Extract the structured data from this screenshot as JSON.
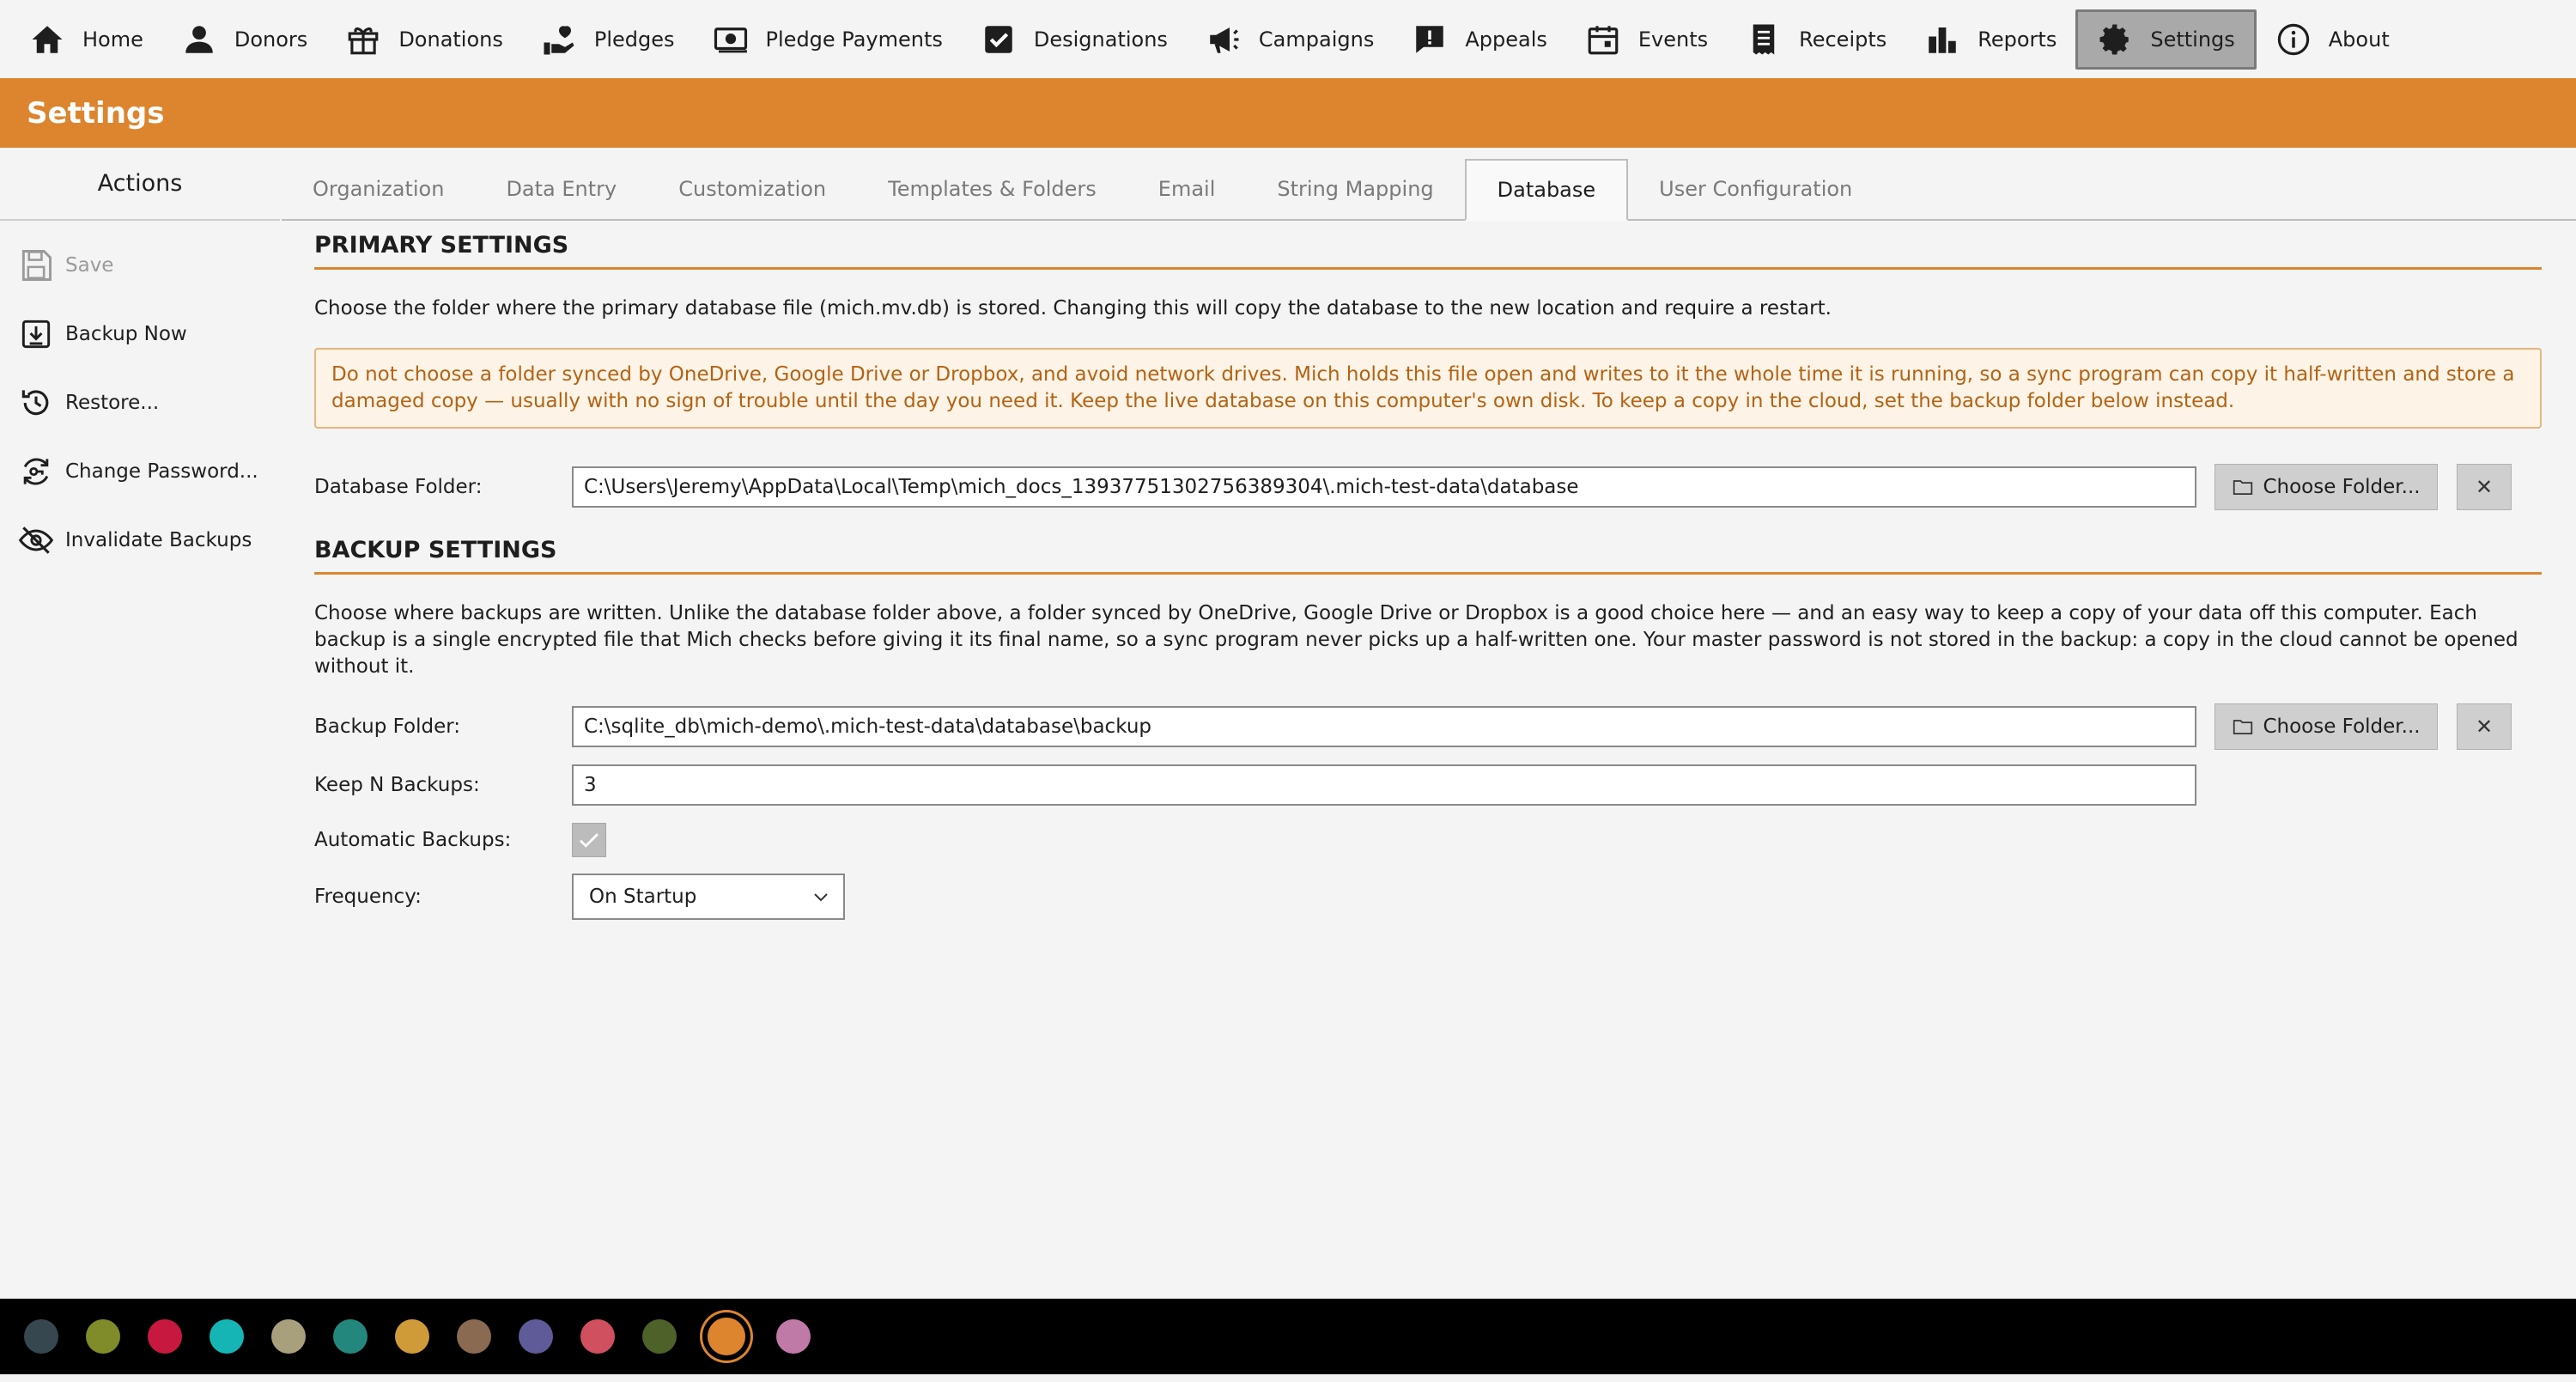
{
  "nav": [
    {
      "id": "home",
      "label": "Home",
      "icon": "home-icon"
    },
    {
      "id": "donors",
      "label": "Donors",
      "icon": "person-icon"
    },
    {
      "id": "donations",
      "label": "Donations",
      "icon": "gift-icon"
    },
    {
      "id": "pledges",
      "label": "Pledges",
      "icon": "pledge-hand-icon"
    },
    {
      "id": "pledge-payments",
      "label": "Pledge Payments",
      "icon": "money-icon"
    },
    {
      "id": "designations",
      "label": "Designations",
      "icon": "checkbox-icon"
    },
    {
      "id": "campaigns",
      "label": "Campaigns",
      "icon": "megaphone-icon"
    },
    {
      "id": "appeals",
      "label": "Appeals",
      "icon": "alert-message-icon"
    },
    {
      "id": "events",
      "label": "Events",
      "icon": "calendar-icon"
    },
    {
      "id": "receipts",
      "label": "Receipts",
      "icon": "receipt-icon"
    },
    {
      "id": "reports",
      "label": "Reports",
      "icon": "bar-chart-icon"
    },
    {
      "id": "settings",
      "label": "Settings",
      "icon": "gear-icon",
      "active": true
    },
    {
      "id": "about",
      "label": "About",
      "icon": "info-icon"
    }
  ],
  "page_title": "Settings",
  "sidebar": {
    "header": "Actions",
    "items": [
      {
        "id": "save",
        "label": "Save",
        "icon": "floppy-disk-icon",
        "disabled": true
      },
      {
        "id": "backup-now",
        "label": "Backup Now",
        "icon": "archive-download-icon",
        "disabled": false
      },
      {
        "id": "restore",
        "label": "Restore...",
        "icon": "restore-history-icon",
        "disabled": false
      },
      {
        "id": "change-password",
        "label": "Change Password...",
        "icon": "key-cycle-icon",
        "disabled": false
      },
      {
        "id": "invalidate-backups",
        "label": "Invalidate Backups",
        "icon": "eye-off-icon",
        "disabled": false
      }
    ]
  },
  "tabs": [
    {
      "id": "organization",
      "label": "Organization"
    },
    {
      "id": "data-entry",
      "label": "Data Entry"
    },
    {
      "id": "customization",
      "label": "Customization"
    },
    {
      "id": "templates-folders",
      "label": "Templates & Folders"
    },
    {
      "id": "email",
      "label": "Email"
    },
    {
      "id": "string-mapping",
      "label": "String Mapping"
    },
    {
      "id": "database",
      "label": "Database",
      "active": true
    },
    {
      "id": "user-configuration",
      "label": "User Configuration"
    }
  ],
  "primary": {
    "title": "PRIMARY SETTINGS",
    "description": "Choose the folder where the primary database file (mich.mv.db) is stored. Changing this will copy the database to the new location and require a restart.",
    "warning": "Do not choose a folder synced by OneDrive, Google Drive or Dropbox, and avoid network drives. Mich holds this file open and writes to it the whole time it is running, so a sync program can copy it half-written and store a damaged copy — usually with no sign of trouble until the day you need it. Keep the live database on this computer's own disk. To keep a copy in the cloud, set the backup folder below instead.",
    "db_folder_label": "Database Folder:",
    "db_folder_value": "C:\\Users\\Jeremy\\AppData\\Local\\Temp\\mich_docs_13937751302756389304\\.mich-test-data\\database",
    "choose_label": "Choose Folder...",
    "clear_label": "✕"
  },
  "backup": {
    "title": "BACKUP SETTINGS",
    "description": "Choose where backups are written. Unlike the database folder above, a folder synced by OneDrive, Google Drive or Dropbox is a good choice here — and an easy way to keep a copy of your data off this computer. Each backup is a single encrypted file that Mich checks before giving it its final name, so a sync program never picks up a half-written one. Your master password is not stored in the backup: a copy in the cloud cannot be opened without it.",
    "folder_label": "Backup Folder:",
    "folder_value": "C:\\sqlite_db\\mich-demo\\.mich-test-data\\database\\backup",
    "choose_label": "Choose Folder...",
    "clear_label": "✕",
    "keep_label": "Keep N Backups:",
    "keep_value": "3",
    "auto_label": "Automatic Backups:",
    "auto_checked": true,
    "frequency_label": "Frequency:",
    "frequency_value": "On Startup"
  },
  "theme_swatches": [
    {
      "color": "#37474f",
      "selected": false
    },
    {
      "color": "#808b2a",
      "selected": false
    },
    {
      "color": "#c7183f",
      "selected": false
    },
    {
      "color": "#16b5b5",
      "selected": false
    },
    {
      "color": "#a89f7c",
      "selected": false
    },
    {
      "color": "#23877d",
      "selected": false
    },
    {
      "color": "#cf9b39",
      "selected": false
    },
    {
      "color": "#8a6b52",
      "selected": false
    },
    {
      "color": "#5f5a98",
      "selected": false
    },
    {
      "color": "#d05060",
      "selected": false
    },
    {
      "color": "#4d6129",
      "selected": false
    },
    {
      "color": "#dc852e",
      "selected": true
    },
    {
      "color": "#c07aa8",
      "selected": false
    }
  ],
  "colors": {
    "accent": "#dc852e",
    "warning_text": "#b36314",
    "warning_bg": "#fdf3e6"
  }
}
